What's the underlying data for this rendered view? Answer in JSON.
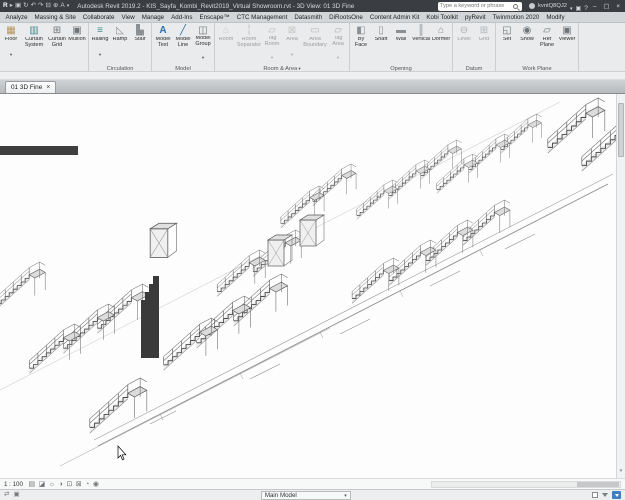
{
  "colors": {
    "titlebar_bg": "#3a3e42",
    "ribbon_bg": "#e9ebec",
    "canvas_bg": "#fdfdfd",
    "accent_blue": "#3e7fc4"
  },
  "titlebar": {
    "title": "Autodesk Revit 2019.2 - KIS_Sayfa_Kombi_Revit2019_Virtual Showroom.rvt - 3D View: 01 3D Fine",
    "search_placeholder": "Type a keyword or phrase",
    "user_id": "kvntQ8QJ2",
    "quick_access_icons": [
      "revit-logo",
      "open",
      "save",
      "sync",
      "undo",
      "redo",
      "print",
      "dimension",
      "text",
      "customize"
    ],
    "right_icons": [
      "user",
      "app-store",
      "help",
      "minimize",
      "maximize",
      "close"
    ]
  },
  "ribbon": {
    "tabs": [
      "Analyze",
      "Massing & Site",
      "Collaborate",
      "View",
      "Manage",
      "Add-Ins",
      "Enscape™",
      "CTC Management",
      "Datasmith",
      "DiRootsOne",
      "Content Admin Kit",
      "Kobi Toolkit",
      "pyRevit",
      "Twinmotion 2020",
      "Modify"
    ],
    "panels": [
      {
        "label": "",
        "tools": [
          {
            "label": "Floor",
            "dropdown": true
          },
          {
            "label": "Curtain System"
          },
          {
            "label": "Curtain Grid"
          },
          {
            "label": "Mullion"
          }
        ]
      },
      {
        "label": "Circulation",
        "tools": [
          {
            "label": "Railing",
            "dropdown": true
          },
          {
            "label": "Ramp"
          },
          {
            "label": "Stair"
          }
        ]
      },
      {
        "label": "Model",
        "tools": [
          {
            "label": "Model Text"
          },
          {
            "label": "Model Line"
          },
          {
            "label": "Model Group",
            "dropdown": true
          }
        ]
      },
      {
        "label": "Room & Area",
        "dropdown": true,
        "tools": [
          {
            "label": "Room",
            "disabled": true
          },
          {
            "label": "Room Separator",
            "disabled": true
          },
          {
            "label": "Tag Room",
            "disabled": true,
            "dropdown": true
          },
          {
            "label": "Area",
            "disabled": true,
            "dropdown": true
          },
          {
            "label": "Area Boundary",
            "disabled": true
          },
          {
            "label": "Tag Area",
            "disabled": true,
            "dropdown": true
          }
        ]
      },
      {
        "label": "Opening",
        "tools": [
          {
            "label": "By Face"
          },
          {
            "label": "Shaft"
          },
          {
            "label": "Wall"
          },
          {
            "label": "Vertical"
          },
          {
            "label": "Dormer"
          }
        ]
      },
      {
        "label": "Datum",
        "tools": [
          {
            "label": "Level",
            "disabled": true
          },
          {
            "label": "Grid",
            "disabled": true
          }
        ]
      },
      {
        "label": "Work Plane",
        "tools": [
          {
            "label": "Set"
          },
          {
            "label": "Show"
          },
          {
            "label": "Ref Plane"
          },
          {
            "label": "Viewer"
          }
        ]
      }
    ]
  },
  "document_tab": {
    "label": "01 3D Fine"
  },
  "view_control_bar": {
    "scale": "1 : 100",
    "icons": [
      "detail-level",
      "visual-style",
      "sun-path",
      "shadows",
      "crop-view",
      "crop-visibility",
      "temporary-hide",
      "reveal-hidden"
    ]
  },
  "status_bar": {
    "design_option": "Main Model",
    "left_icons": [
      "worksets",
      "design-options"
    ],
    "right_icons": [
      "exclude-options-checkbox",
      "filter",
      "selection-filter"
    ]
  }
}
